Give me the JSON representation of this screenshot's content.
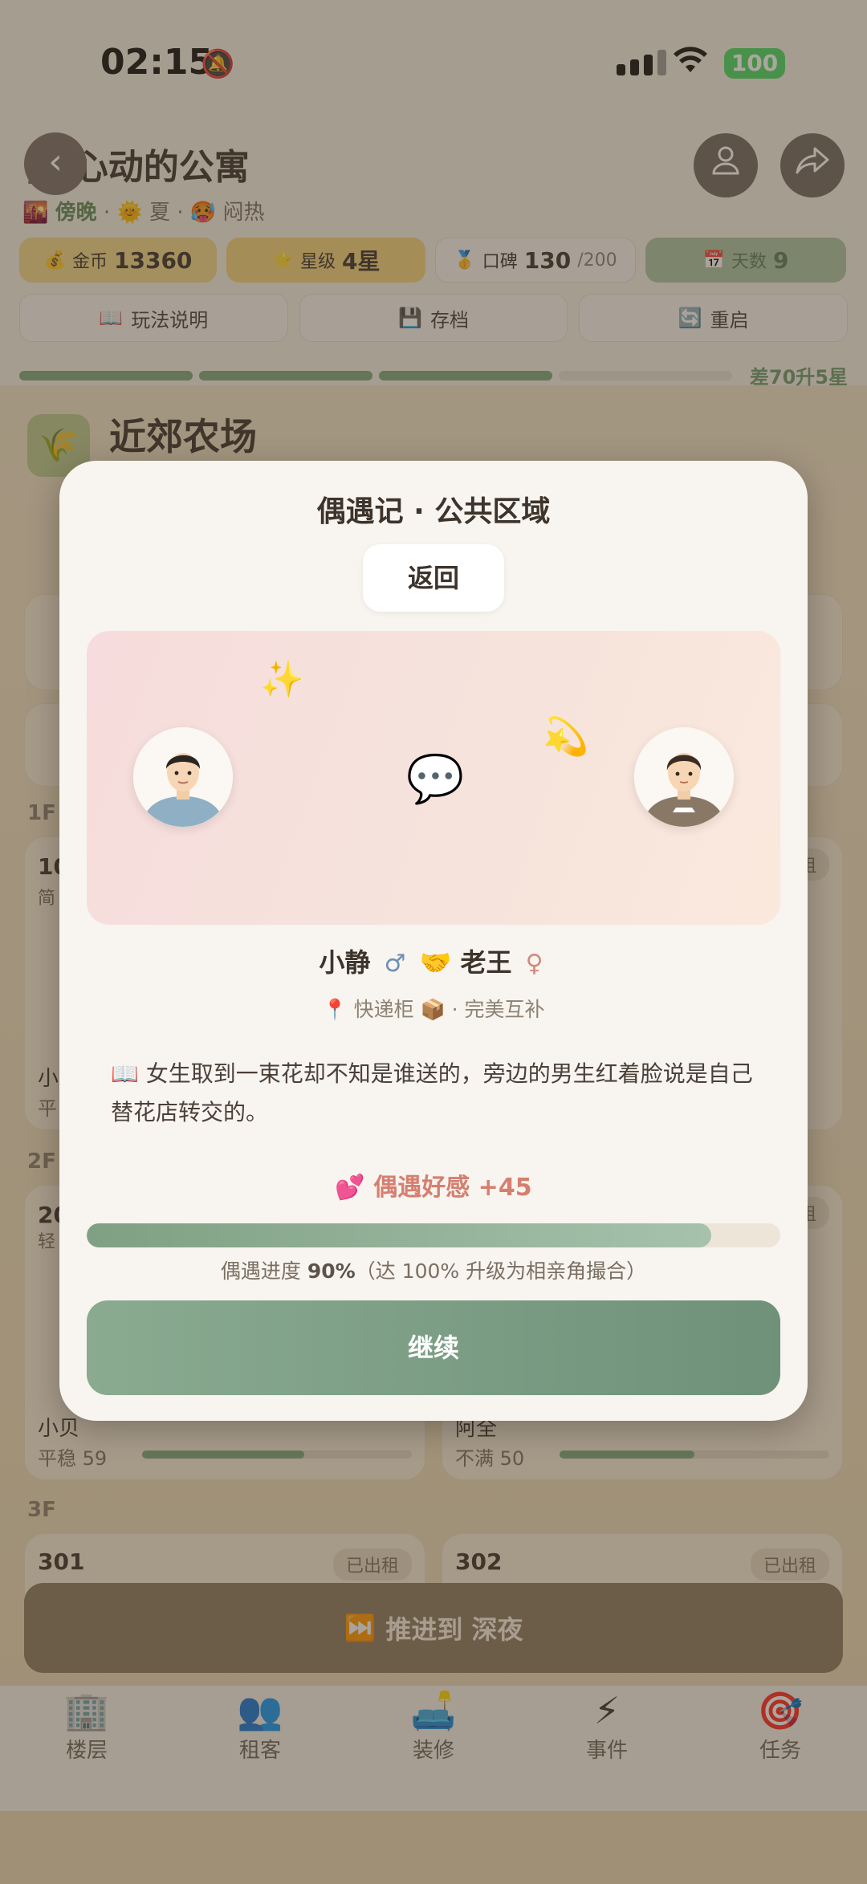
{
  "status": {
    "time": "02:15",
    "battery": "100"
  },
  "header": {
    "title": "心动的公寓",
    "time_of_day": "傍晚",
    "season": "夏",
    "weather": "闷热"
  },
  "stats": {
    "coins_label": "金币",
    "coins": "13360",
    "star_label": "星级",
    "star": "4星",
    "rep_label": "口碑",
    "rep": "130",
    "rep_max": "/200",
    "day_label": "天数",
    "day": "9"
  },
  "tools": {
    "rules": "玩法说明",
    "save": "存档",
    "restart": "重启"
  },
  "level": {
    "progress_segments_filled": 3,
    "need_text": "差70升5星"
  },
  "background": {
    "farm_title": "近郊农场",
    "floors": [
      "1F",
      "2F",
      "3F"
    ],
    "rooms": {
      "r1": "10",
      "r1_sub": "简",
      "r2": "20",
      "r2_sub": "轻",
      "r301": "301",
      "r302": "302",
      "rented": "已出租",
      "rented_short": "租"
    },
    "tenants": {
      "t1_name": "小",
      "t1_mood": "平",
      "t2_name": "小贝",
      "t2_mood": "平稳 59",
      "t2_happiness": 0.6,
      "t3_name": "阿全",
      "t3_mood": "不满 50",
      "t3_happiness": 0.5
    },
    "advance_label": "推进到 深夜"
  },
  "tabs": [
    "楼层",
    "租客",
    "装修",
    "事件",
    "任务"
  ],
  "modal": {
    "title": "偶遇记 · 公共区域",
    "back_label": "返回",
    "name_a": "小静",
    "gender_a": "♂",
    "name_b": "老王",
    "gender_b": "♀",
    "place": "快递柜",
    "match": "· 完美互补",
    "story": "女生取到一束花却不知是谁送的，旁边的男生红着脸说是自己替花店转交的。",
    "favor": "偶遇好感 +45",
    "progress": 0.9,
    "progress_label": "偶遇进度",
    "progress_value": "90%",
    "progress_note": "（达 100% 升级为相亲角撮合）",
    "continue_label": "继续"
  }
}
